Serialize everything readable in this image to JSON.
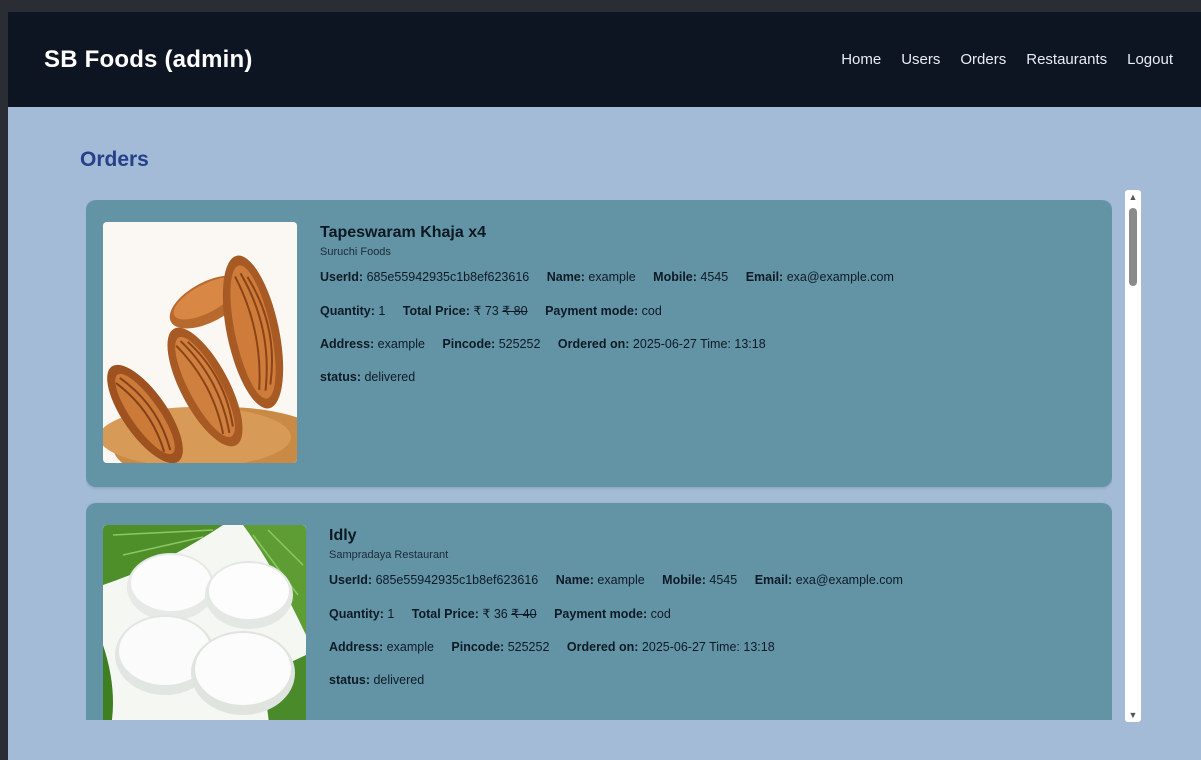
{
  "header": {
    "brand": "SB Foods (admin)",
    "nav": [
      "Home",
      "Users",
      "Orders",
      "Restaurants",
      "Logout"
    ]
  },
  "page": {
    "title": "Orders"
  },
  "labels": {
    "userid": "UserId:",
    "name": "Name:",
    "mobile": "Mobile:",
    "email": "Email:",
    "quantity": "Quantity:",
    "total_price": "Total Price:",
    "payment_mode": "Payment mode:",
    "address": "Address:",
    "pincode": "Pincode:",
    "ordered_on": "Ordered on:",
    "status": "status:"
  },
  "orders": [
    {
      "title": "Tapeswaram Khaja x4",
      "restaurant": "Suruchi Foods",
      "userid": "685e55942935c1b8ef623616",
      "name": "example",
      "mobile": "4545",
      "email": "exa@example.com",
      "quantity": "1",
      "price": "₹ 73",
      "original_price": "₹ 80",
      "payment_mode": "cod",
      "address": "example",
      "pincode": "525252",
      "ordered_on": "2025-06-27 Time: 13:18",
      "status": "delivered",
      "image": "khaja-photo"
    },
    {
      "title": "Idly",
      "restaurant": "Sampradaya Restaurant",
      "userid": "685e55942935c1b8ef623616",
      "name": "example",
      "mobile": "4545",
      "email": "exa@example.com",
      "quantity": "1",
      "price": "₹ 36",
      "original_price": "₹ 40",
      "payment_mode": "cod",
      "address": "example",
      "pincode": "525252",
      "ordered_on": "2025-06-27 Time: 13:18",
      "status": "delivered",
      "image": "idly-photo"
    }
  ],
  "colors": {
    "navbar": "#0e1522",
    "page_bg": "#a3bbd6",
    "card_bg": "#6394a6",
    "title": "#27408b"
  }
}
